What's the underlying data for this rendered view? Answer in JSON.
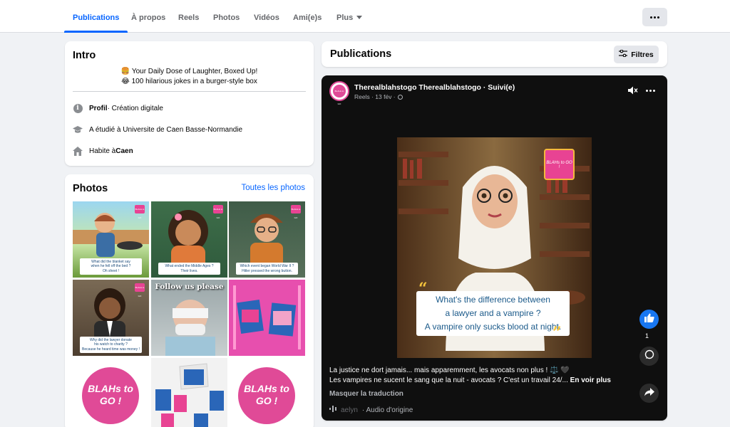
{
  "tabs": [
    {
      "label": "Publications",
      "active": true
    },
    {
      "label": "À propos"
    },
    {
      "label": "Reels"
    },
    {
      "label": "Photos"
    },
    {
      "label": "Vidéos"
    },
    {
      "label": "Ami(e)s"
    },
    {
      "label": "Plus"
    }
  ],
  "intro": {
    "title": "Intro",
    "bio_line1": "🍔 Your Daily Dose of Laughter, Boxed Up!",
    "bio_line2": "😂 100 hilarious jokes in a burger-style box",
    "profile_label": "Profil",
    "profile_value": " · Création digitale",
    "education": "A étudié à Universite de Caen Basse-Normandie",
    "lives_prefix": "Habite à ",
    "lives_city": "Caen"
  },
  "photos": {
    "title": "Photos",
    "see_all": "Toutes les photos",
    "tiles": [
      {
        "caption1": "What did the blanket say",
        "caption2": "when he fell off the bed ?",
        "caption3": "Oh sheet !"
      },
      {
        "caption1": "What ended the Middle Ages ?",
        "caption2": "Their lives."
      },
      {
        "caption1": "Which event began World War II ?",
        "caption2": "Hitler pressed the wrong button."
      },
      {
        "caption1": "Why did the lawyer donate",
        "caption2": "his watch to charity ?",
        "caption3": "Because he heard time was money !"
      },
      {
        "overlay": "Follow us please"
      },
      {},
      {
        "logo": "BLAHs to GO !"
      },
      {},
      {
        "logo": "BLAHs to GO !"
      }
    ],
    "badge_text": "BLAHs to GO"
  },
  "publications": {
    "title": "Publications",
    "filter_label": "Filtres"
  },
  "post": {
    "author": "Therealblahstogo Therealblahstogo · Suivi(e)",
    "meta": "Reels · 13 fév ·",
    "reel_caption1": "What's the difference between",
    "reel_caption2": "a lawyer and a vampire ?",
    "reel_caption3": "A vampire only sucks blood at night.",
    "reel_badge": "BLAHs to GO !",
    "avatar_text": "BLAHs to GO",
    "like_count": "1",
    "text_line1": "La justice ne dort jamais... mais apparemment, les avocats non plus ! ⚖️ 🖤",
    "text_line2": "Les vampires ne sucent le sang que la nuit - avocats ? C'est un travail 24/... ",
    "see_more": "En voir plus",
    "translate": "Masquer la traduction",
    "audio_user": "aelyn",
    "audio_label": "· Audio d'origine"
  },
  "colors": {
    "accent": "#0866ff",
    "brand_pink": "#e04a97",
    "post_bg": "#0f0f0f"
  },
  "icons": [
    "info-icon",
    "graduation-cap-icon",
    "home-icon",
    "filter-icon",
    "mute-icon",
    "like-icon",
    "comment-icon",
    "share-icon",
    "globe-icon",
    "audio-icon"
  ]
}
